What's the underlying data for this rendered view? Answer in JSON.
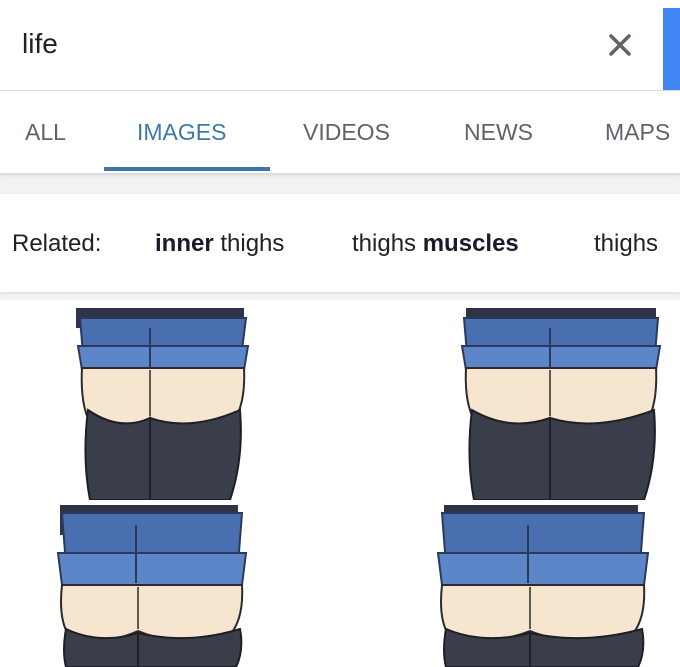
{
  "search": {
    "query": "life",
    "clear_icon": "close-icon",
    "accent_color": "#4285f4"
  },
  "tabs": [
    {
      "label": "ALL",
      "active": false
    },
    {
      "label": "IMAGES",
      "active": true
    },
    {
      "label": "VIDEOS",
      "active": false
    },
    {
      "label": "NEWS",
      "active": false
    },
    {
      "label": "MAPS",
      "active": false
    }
  ],
  "related": {
    "label": "Related:",
    "chips": [
      {
        "bold": "inner",
        "rest": " thighs"
      },
      {
        "pre": "thighs ",
        "bold": "muscles"
      },
      {
        "pre": "thighs"
      }
    ]
  },
  "results": {
    "count_visible": 4,
    "colors": {
      "shorts": "#4a6fb0",
      "shorts_cuff": "#5c86c8",
      "skin": "#f6e6d0",
      "stockings": "#3a3d4a"
    }
  }
}
